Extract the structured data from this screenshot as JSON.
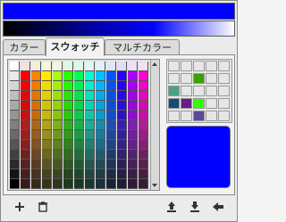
{
  "colors": {
    "current": "#0000ff"
  },
  "tabs": [
    {
      "label": "カラー",
      "active": false
    },
    {
      "label": "スウォッチ",
      "active": true
    },
    {
      "label": "マルチカラー",
      "active": false
    }
  ],
  "toolbar": {
    "add_icon": "plus-icon",
    "delete_icon": "trash-icon",
    "upload_icon": "upload-icon",
    "download_icon": "download-icon",
    "back_icon": "arrow-left-icon"
  },
  "custom_swatches": [
    "#e6e6e6",
    "#e6e6e6",
    "#e6e6e6",
    "#e6e6e6",
    "#e6e6e6",
    "#e6e6e6",
    "#e6e6e6",
    "#3aa000",
    "#e6e6e6",
    "#e6e6e6",
    "#4aa384",
    "#e6e6e6",
    "#e6e6e6",
    "#e6e6e6",
    "#e6e6e6",
    "#1a4a74",
    "#6a1a8a",
    "#33ff00",
    "#e6e6e6",
    "#e6e6e6",
    "#e6e6e6",
    "#e6e6e6",
    "#5a4a9a",
    "#e6e6e6",
    "#e6e6e6"
  ]
}
